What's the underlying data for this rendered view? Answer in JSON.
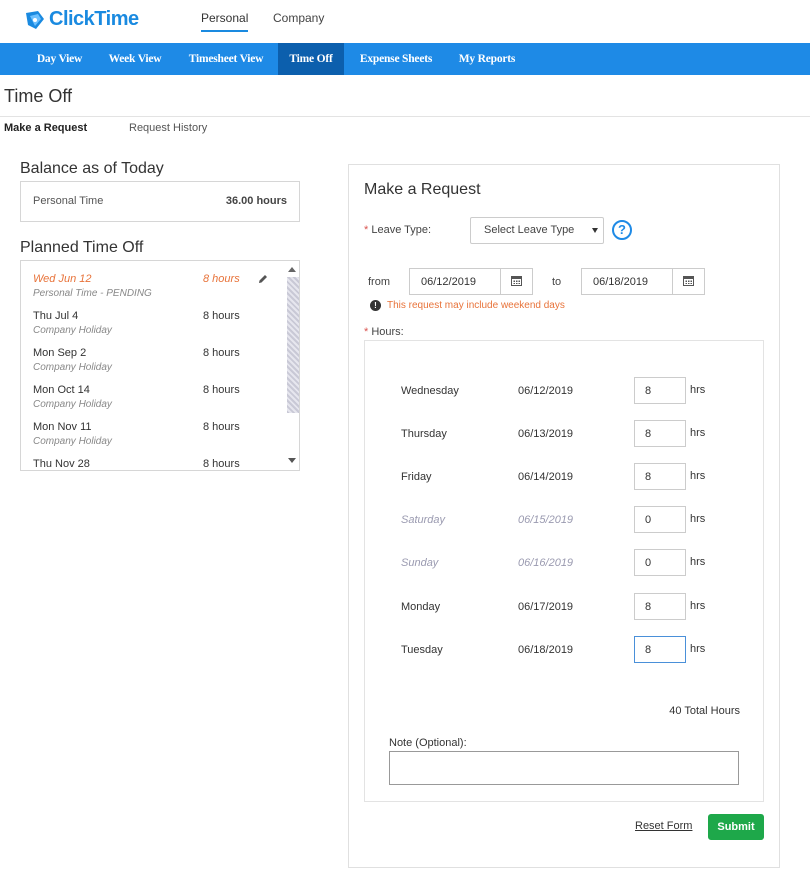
{
  "app": {
    "name": "ClickTime"
  },
  "top_tabs": [
    {
      "label": "Personal",
      "active": true
    },
    {
      "label": "Company",
      "active": false
    }
  ],
  "nav": [
    {
      "label": "Day View",
      "active": false
    },
    {
      "label": "Week View",
      "active": false
    },
    {
      "label": "Timesheet View",
      "active": false
    },
    {
      "label": "Time Off",
      "active": true
    },
    {
      "label": "Expense Sheets",
      "active": false
    },
    {
      "label": "My Reports",
      "active": false
    }
  ],
  "page_title": "Time Off",
  "subtabs": [
    {
      "label": "Make a Request",
      "active": true
    },
    {
      "label": "Request History",
      "active": false
    }
  ],
  "balance": {
    "heading": "Balance as of Today",
    "label": "Personal Time",
    "value": "36.00 hours"
  },
  "planned": {
    "heading": "Planned Time Off",
    "items": [
      {
        "date": "Wed Jun 12",
        "sub": "Personal Time - PENDING",
        "hours": "8 hours",
        "pending": true,
        "icon": "pencil-icon"
      },
      {
        "date": "Thu Jul 4",
        "sub": "Company Holiday",
        "hours": "8 hours"
      },
      {
        "date": "Mon Sep 2",
        "sub": "Company Holiday",
        "hours": "8 hours"
      },
      {
        "date": "Mon Oct 14",
        "sub": "Company Holiday",
        "hours": "8 hours"
      },
      {
        "date": "Mon Nov 11",
        "sub": "Company Holiday",
        "hours": "8 hours"
      },
      {
        "date": "Thu Nov 28",
        "sub": "",
        "hours": "8 hours"
      }
    ]
  },
  "request": {
    "title": "Make a Request",
    "required_mark": "*",
    "leave_type_label": "Leave Type:",
    "leave_type_value": "Select Leave Type",
    "help_icon": "question-circle-icon",
    "from_label": "from",
    "from_date": "06/12/2019",
    "to_label": "to",
    "to_date": "06/18/2019",
    "warning_icon": "exclamation-circle-icon",
    "warning": "This request may include weekend days",
    "hours_label": "Hours:",
    "unit": "hrs",
    "days": [
      {
        "name": "Wednesday",
        "date": "06/12/2019",
        "hours": "8",
        "weekend": false
      },
      {
        "name": "Thursday",
        "date": "06/13/2019",
        "hours": "8",
        "weekend": false
      },
      {
        "name": "Friday",
        "date": "06/14/2019",
        "hours": "8",
        "weekend": false
      },
      {
        "name": "Saturday",
        "date": "06/15/2019",
        "hours": "0",
        "weekend": true
      },
      {
        "name": "Sunday",
        "date": "06/16/2019",
        "hours": "0",
        "weekend": true
      },
      {
        "name": "Monday",
        "date": "06/17/2019",
        "hours": "8",
        "weekend": false
      },
      {
        "name": "Tuesday",
        "date": "06/18/2019",
        "hours": "8",
        "weekend": false
      }
    ],
    "total": "40 Total Hours",
    "note_label": "Note (Optional):",
    "note_value": "",
    "reset_label": "Reset Form",
    "submit_label": "Submit"
  },
  "colors": {
    "brand_blue": "#1e8ae6",
    "nav_active": "#0c5fad",
    "pending_orange": "#e8733a",
    "submit_green": "#1ea84a"
  }
}
